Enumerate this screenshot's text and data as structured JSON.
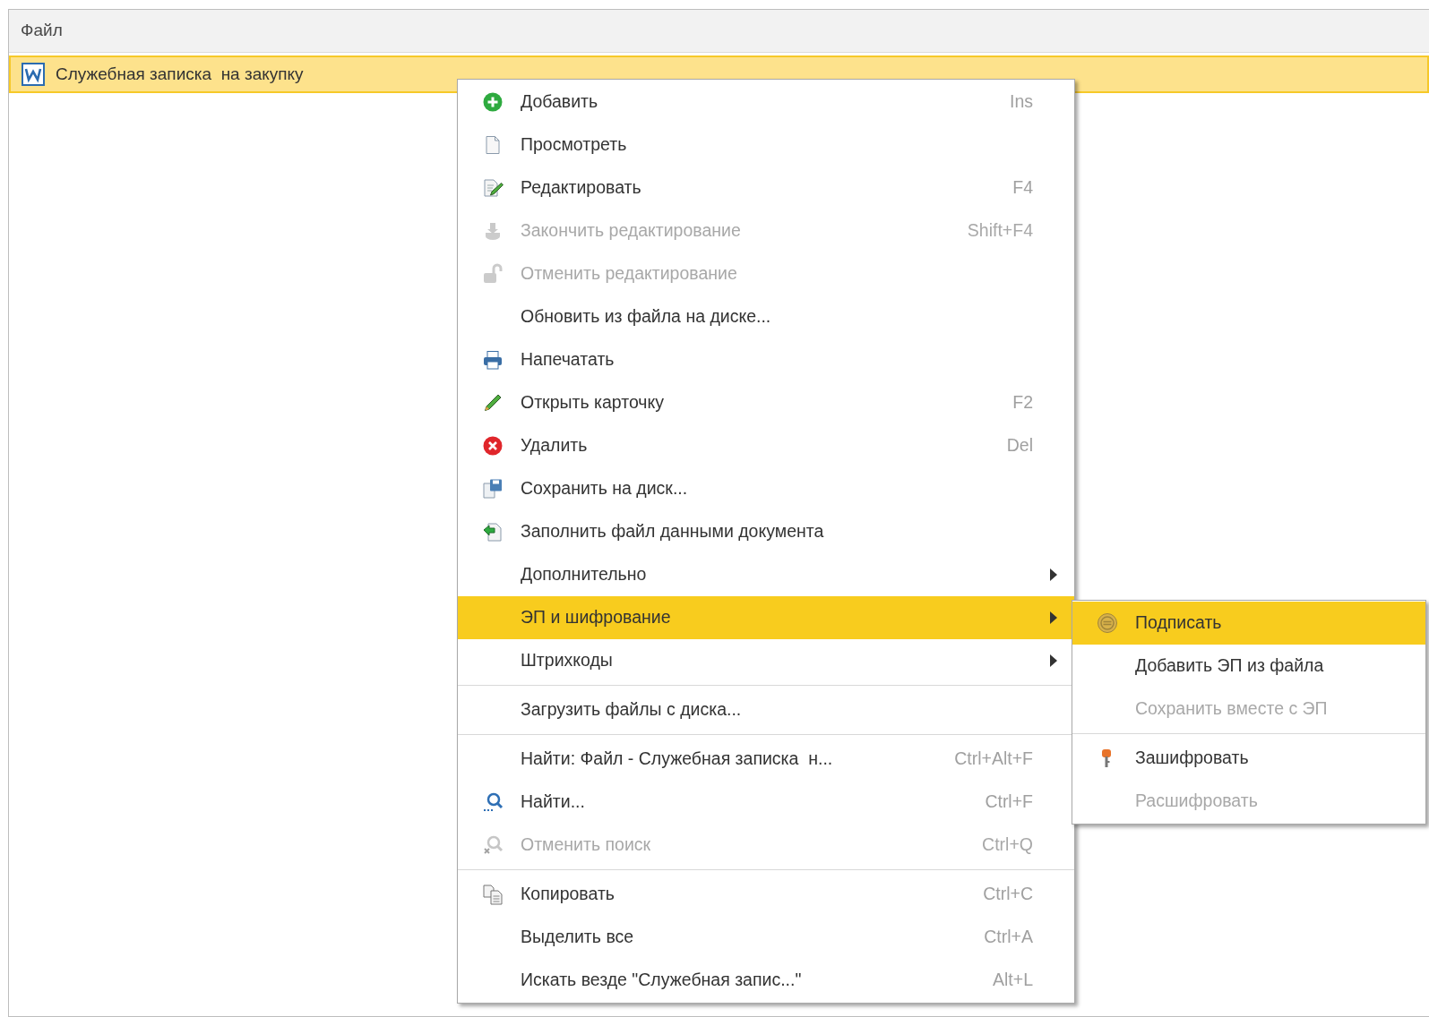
{
  "header": {
    "title": "Файл"
  },
  "row": {
    "title": "Служебная записка  на закупку",
    "selected": true
  },
  "context_menu": {
    "items": [
      {
        "label": "Добавить",
        "shortcut": "Ins",
        "disabled": false,
        "selected": false
      },
      {
        "label": "Просмотреть",
        "disabled": false,
        "selected": false
      },
      {
        "label": "Редактировать",
        "shortcut": "F4",
        "disabled": false,
        "selected": false
      },
      {
        "label": "Закончить редактирование",
        "shortcut": "Shift+F4",
        "disabled": true,
        "selected": false
      },
      {
        "label": "Отменить редактирование",
        "disabled": true,
        "selected": false
      },
      {
        "label": "Обновить из файла на диске...",
        "disabled": false,
        "selected": false
      },
      {
        "label": "Напечатать",
        "disabled": false,
        "selected": false
      },
      {
        "label": "Открыть карточку",
        "shortcut": "F2",
        "disabled": false,
        "selected": false
      },
      {
        "label": "Удалить",
        "shortcut": "Del",
        "disabled": false,
        "selected": false
      },
      {
        "label": "Сохранить на диск...",
        "disabled": false,
        "selected": false
      },
      {
        "label": "Заполнить файл данными документа",
        "disabled": false,
        "selected": false
      },
      {
        "label": "Дополнительно",
        "submenu": true,
        "disabled": false,
        "selected": false
      },
      {
        "label": "ЭП и шифрование",
        "submenu": true,
        "disabled": false,
        "selected": true
      },
      {
        "label": "Штрихкоды",
        "submenu": true,
        "disabled": false,
        "selected": false
      },
      {
        "label": "Загрузить файлы с диска...",
        "separator_before": true,
        "disabled": false,
        "selected": false
      },
      {
        "label": "Найти: Файл - Служебная записка  н...",
        "shortcut": "Ctrl+Alt+F",
        "separator_before": true,
        "disabled": false,
        "selected": false
      },
      {
        "label": "Найти...",
        "shortcut": "Ctrl+F",
        "disabled": false,
        "selected": false
      },
      {
        "label": "Отменить поиск",
        "shortcut": "Ctrl+Q",
        "disabled": true,
        "selected": false
      },
      {
        "label": "Копировать",
        "shortcut": "Ctrl+C",
        "separator_before": true,
        "disabled": false,
        "selected": false
      },
      {
        "label": "Выделить все",
        "shortcut": "Ctrl+A",
        "disabled": false,
        "selected": false
      },
      {
        "label": "Искать везде \"Служебная запис...\"",
        "shortcut": "Alt+L",
        "disabled": false,
        "selected": false
      }
    ]
  },
  "submenu": {
    "items": [
      {
        "label": "Подписать",
        "disabled": false,
        "selected": true
      },
      {
        "label": "Добавить ЭП из файла",
        "disabled": false,
        "selected": false
      },
      {
        "label": "Сохранить вместе с ЭП",
        "disabled": true,
        "selected": false
      },
      {
        "label": "Зашифровать",
        "separator_before": true,
        "disabled": false,
        "selected": false
      },
      {
        "label": "Расшифровать",
        "disabled": true,
        "selected": false
      }
    ]
  }
}
